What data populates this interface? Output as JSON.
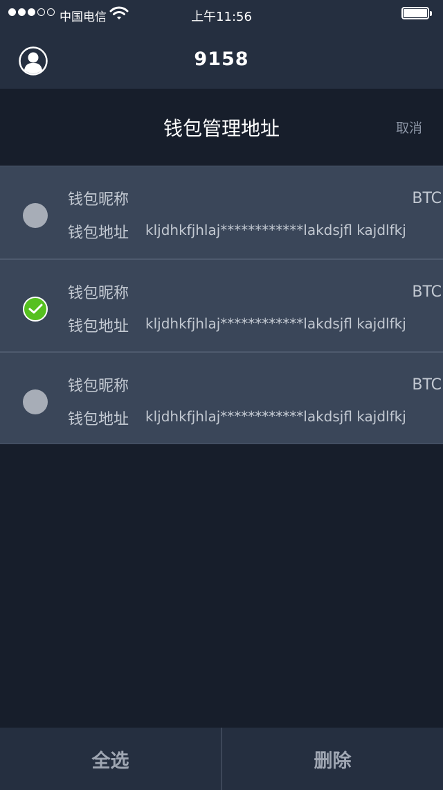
{
  "status_bar": {
    "carrier": "中国电信",
    "time": "上午11:56"
  },
  "header": {
    "title": "9158",
    "avatar_icon": "user-avatar-icon"
  },
  "subheader": {
    "title": "钱包管理地址",
    "cancel_label": "取消"
  },
  "wallets": [
    {
      "nickname": "钱包昵称",
      "coin": "BTC",
      "address_label": "钱包地址",
      "address": "kljdhkfjhlaj************lakdsjfl kajdlfkj",
      "selected": false
    },
    {
      "nickname": "钱包昵称",
      "coin": "BTC",
      "address_label": "钱包地址",
      "address": "kljdhkfjhlaj************lakdsjfl kajdlfkj",
      "selected": true
    },
    {
      "nickname": "钱包昵称",
      "coin": "BTC",
      "address_label": "钱包地址",
      "address": "kljdhkfjhlaj************lakdsjfl kajdlfkj",
      "selected": false
    }
  ],
  "footer": {
    "select_all_label": "全选",
    "delete_label": "删除"
  },
  "colors": {
    "background": "#171e2b",
    "bar": "#252f40",
    "row": "#3a4659",
    "checked": "#56c01f"
  }
}
